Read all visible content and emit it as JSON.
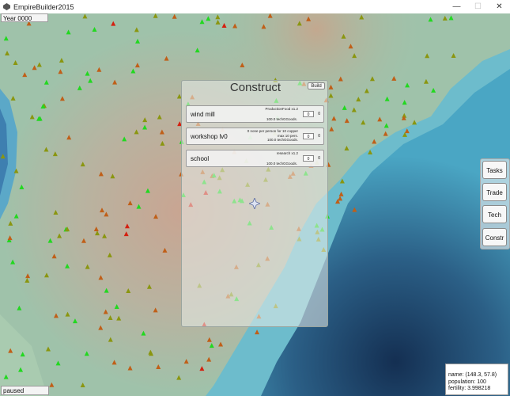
{
  "window": {
    "title": "EmpireBuilder2015",
    "minimize": "—",
    "maximize": "☐",
    "close": "✕"
  },
  "colors": {
    "land": "#9fbfaa",
    "land_center": "#c2a99a",
    "shallow": "#6bb5c7",
    "deep": "#1d3f63",
    "tree_green": "#22d820",
    "tree_olive": "#8a9610",
    "tree_orange": "#c05f18",
    "tree_red": "#d42010"
  },
  "hud": {
    "year": "Year 0000",
    "status": "paused"
  },
  "construct": {
    "title": "Construct",
    "build_label": "Build",
    "items": [
      {
        "name": "wind mill",
        "desc": [
          "ProductionFood x1.2"
        ],
        "cost": "100.0 techGGoods.",
        "count": "0",
        "built": "0"
      },
      {
        "name": "workshop lv0",
        "desc": [
          "0 none per person for 10 copper",
          "max 10 pers.",
          "100.0 techGGoods."
        ],
        "cost": "",
        "count": "0",
        "built": "0"
      },
      {
        "name": "school",
        "desc": [
          "research x1.2"
        ],
        "cost": "100.0 techGGoods.",
        "count": "0",
        "built": "0"
      }
    ]
  },
  "side_menu": {
    "tasks": "Tasks",
    "trade": "Trade",
    "tech": "Tech",
    "constr": "Constr"
  },
  "info": {
    "name": "name: (148.3, 57.8)",
    "population": "population: 100",
    "fertility": "fertility: 3.998218"
  }
}
